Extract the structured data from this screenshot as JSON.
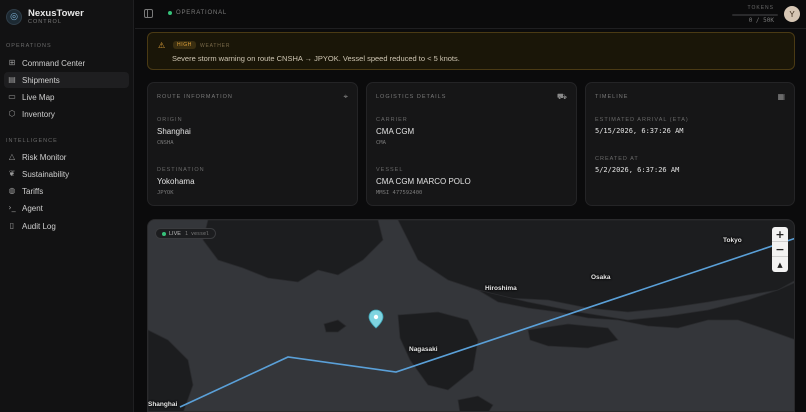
{
  "brand": {
    "name": "NexusTower",
    "subtitle": "CONTROL"
  },
  "sidebar": {
    "sections": [
      {
        "label": "OPERATIONS",
        "items": [
          {
            "label": "Command Center",
            "icon": "grid-icon",
            "active": false
          },
          {
            "label": "Shipments",
            "icon": "box-icon",
            "active": true
          },
          {
            "label": "Live Map",
            "icon": "map-icon",
            "active": false
          },
          {
            "label": "Inventory",
            "icon": "package-icon",
            "active": false
          }
        ]
      },
      {
        "label": "INTELLIGENCE",
        "items": [
          {
            "label": "Risk Monitor",
            "icon": "warning-icon",
            "active": false
          },
          {
            "label": "Sustainability",
            "icon": "leaf-icon",
            "active": false
          },
          {
            "label": "Tariffs",
            "icon": "globe-icon",
            "active": false
          },
          {
            "label": "Agent",
            "icon": "terminal-icon",
            "active": false
          },
          {
            "label": "Audit Log",
            "icon": "document-icon",
            "active": false
          }
        ]
      }
    ]
  },
  "topbar": {
    "status": "OPERATIONAL",
    "tokens_label": "TOKENS",
    "tokens_value": "0 / 50K",
    "tokens_fraction": 0,
    "avatar_initial": "Y"
  },
  "alert": {
    "severity": "HIGH",
    "category": "WEATHER",
    "message": "Severe storm warning on route CNSHA → JPYOK. Vessel speed reduced to < 5 knots."
  },
  "route": {
    "title": "ROUTE INFORMATION",
    "origin_label": "ORIGIN",
    "origin": "Shanghai",
    "origin_code": "CNSHA",
    "destination_label": "DESTINATION",
    "destination": "Yokohama",
    "destination_code": "JPYOK"
  },
  "logistics": {
    "title": "LOGISTICS DETAILS",
    "carrier_label": "CARRIER",
    "carrier": "CMA CGM",
    "carrier_code": "CMA",
    "vessel_label": "VESSEL",
    "vessel": "CMA CGM MARCO POLO",
    "mmsi": "MMSI 477592400"
  },
  "timeline": {
    "title": "TIMELINE",
    "eta_label": "ESTIMATED ARRIVAL (ETA)",
    "eta": "5/15/2026, 6:37:26 AM",
    "created_label": "CREATED AT",
    "created": "5/2/2026, 6:37:26 AM"
  },
  "map": {
    "live_label": "LIVE",
    "vessel_count": "1 vessel",
    "zoom_in": "+",
    "zoom_out": "−",
    "reset": "▲",
    "labels": {
      "tokyo": "Tokyo",
      "osaka": "Osaka",
      "hiroshima": "Hiroshima",
      "nagasaki": "Nagasaki",
      "shanghai": "Shanghai"
    },
    "route_color": "#5aa0d8"
  },
  "colors": {
    "accent": "#5aa0d8",
    "ok": "#36c27a",
    "warning": "#e0a23a"
  }
}
